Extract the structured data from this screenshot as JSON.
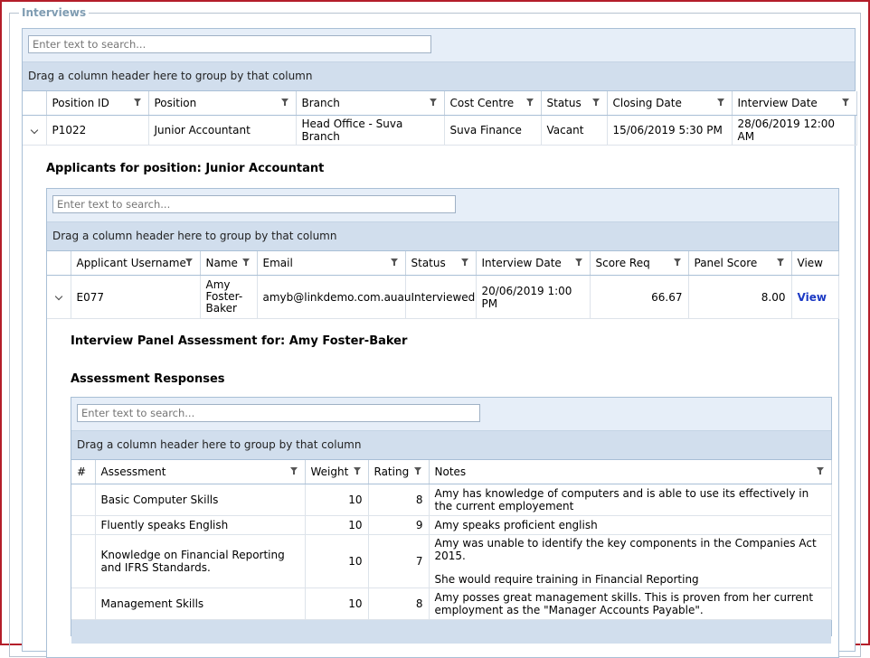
{
  "fieldset": {
    "legend": "Interviews"
  },
  "positions_grid": {
    "search_placeholder": "Enter text to search...",
    "group_text": "Drag a column header here to group by that column",
    "columns": [
      "Position ID",
      "Position",
      "Branch",
      "Cost Centre",
      "Status",
      "Closing Date",
      "Interview Date"
    ],
    "row": {
      "position_id": "P1022",
      "position": "Junior Accountant",
      "branch": "Head Office - Suva Branch",
      "cost_centre": "Suva Finance",
      "status": "Vacant",
      "closing_date": "15/06/2019 5:30 PM",
      "interview_date": "28/06/2019 12:00 AM"
    }
  },
  "applicants": {
    "title": "Applicants for position: Junior Accountant",
    "search_placeholder": "Enter text to search...",
    "group_text": "Drag a column header here to group by that column",
    "columns": [
      "Applicant Username",
      "Name",
      "Email",
      "Status",
      "Interview Date",
      "Score Req",
      "Panel Score",
      "View"
    ],
    "row": {
      "username": "E077",
      "name": "Amy Foster-Baker",
      "email": "amyb@linkdemo.com.auau",
      "status": "Interviewed",
      "interview_date": "20/06/2019 1:00 PM",
      "score_req": "66.67",
      "panel_score": "8.00",
      "view": "View"
    }
  },
  "assessment": {
    "panel_title": "Interview Panel Assessment for: Amy Foster-Baker",
    "responses_title": "Assessment Responses",
    "search_placeholder": "Enter text to search...",
    "group_text": "Drag a column header here to group by that column",
    "columns": [
      "#",
      "Assessment",
      "Weight",
      "Rating",
      "Notes"
    ],
    "rows": [
      {
        "assessment": "Basic Computer Skills",
        "weight": "10",
        "rating": "8",
        "notes": "Amy has knowledge of computers and is able to use its effectively in the current employement",
        "notes2": ""
      },
      {
        "assessment": "Fluently speaks English",
        "weight": "10",
        "rating": "9",
        "notes": "Amy speaks proficient english",
        "notes2": ""
      },
      {
        "assessment": "Knowledge on Financial Reporting and IFRS Standards.",
        "weight": "10",
        "rating": "7",
        "notes": "Amy was unable to identify the key components in the Companies Act 2015.",
        "notes2": "She would require training in Financial Reporting"
      },
      {
        "assessment": "Management Skills",
        "weight": "10",
        "rating": "8",
        "notes": "Amy posses great management skills. This is proven from her current employment as the \"Manager Accounts Payable\".",
        "notes2": ""
      }
    ]
  }
}
